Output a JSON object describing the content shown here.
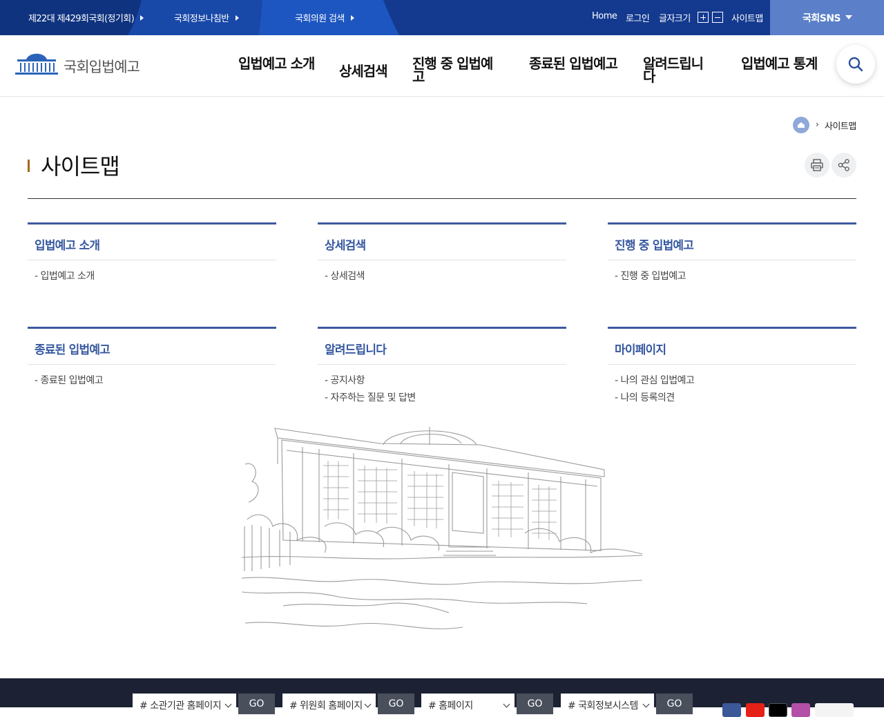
{
  "top_bar": {
    "links": [
      {
        "label": "제22대 제429회국회(정기회)"
      },
      {
        "label": "국회정보나침반"
      },
      {
        "label": "국회의원 검색"
      }
    ],
    "home": "Home",
    "login": "로그인",
    "font_size": "글자크기",
    "sitemap": "사이트맵",
    "sns": "국회SNS",
    "colors": {
      "bar": "#123a8c",
      "sns_bg": "#5b80c9"
    }
  },
  "header": {
    "logo_text": "국회입법예고",
    "gnb": [
      {
        "label": "입법예고 소개"
      },
      {
        "label": "상세검색"
      },
      {
        "label": "진행 중 입법예고"
      },
      {
        "label": "종료된 입법예고"
      },
      {
        "label": "알려드립니다"
      },
      {
        "label": "입법예고 통계"
      }
    ]
  },
  "breadcrumb": {
    "current": "사이트맵"
  },
  "page": {
    "title": "사이트맵"
  },
  "sitemap": [
    {
      "title": "입법예고 소개",
      "items": [
        "- 입법예고 소개"
      ]
    },
    {
      "title": "상세검색",
      "items": [
        "- 상세검색"
      ]
    },
    {
      "title": "진행 중 입법예고",
      "items": [
        "- 진행 중 입법예고"
      ]
    },
    {
      "title": "종료된 입법예고",
      "items": [
        "- 종료된 입법예고"
      ]
    },
    {
      "title": "알려드립니다",
      "items": [
        "- 공지사항",
        "- 자주하는 질문 및 답변"
      ]
    },
    {
      "title": "마이페이지",
      "items": [
        "- 나의 관심 입법예고",
        "- 나의 등록의견"
      ]
    }
  ],
  "footer": {
    "selects": [
      {
        "label": "# 소관기관 홈페이지",
        "go": "GO"
      },
      {
        "label": "# 위원회 홈페이지",
        "go": "GO"
      },
      {
        "label": "# 홈페이지",
        "go": "GO"
      },
      {
        "label": "# 국회정보시스템",
        "go": "GO"
      }
    ],
    "sns_icons": [
      "facebook-icon",
      "youtube-icon",
      "x-icon",
      "instagram-icon",
      "blog-icon"
    ]
  },
  "accent": {
    "title_blue": "#3658a0",
    "title_bar": "#a36a1f"
  }
}
